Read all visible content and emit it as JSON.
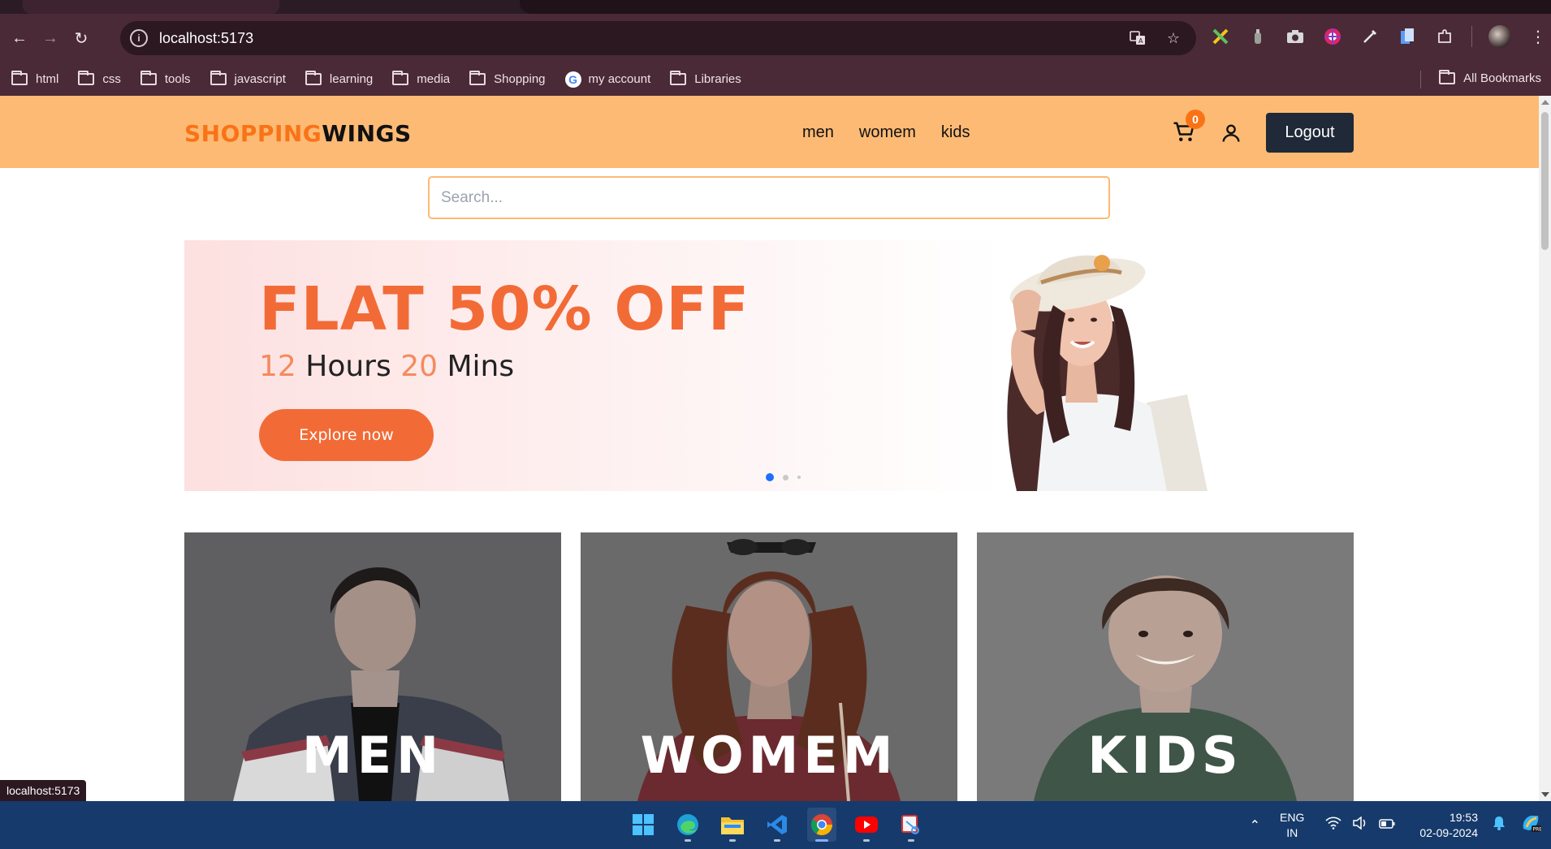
{
  "browser": {
    "url": "localhost:5173",
    "status_url": "localhost:5173",
    "bookmarks": [
      "html",
      "css",
      "tools",
      "javascript",
      "learning",
      "media",
      "Shopping",
      "my account",
      "Libraries"
    ],
    "all_bookmarks_label": "All Bookmarks"
  },
  "site": {
    "logo_part1": "SHOPPING",
    "logo_part2": "WINGS",
    "nav": [
      "men",
      "womem",
      "kids"
    ],
    "cart_count": "0",
    "logout_label": "Logout",
    "search_placeholder": "Search...",
    "accent_color": "#f97316",
    "header_color": "#fdba74"
  },
  "hero": {
    "title": "FLAT 50% OFF",
    "hours_value": "12",
    "hours_label": "Hours",
    "mins_value": "20",
    "mins_label": "Mins",
    "cta_label": "Explore now",
    "slides": 3,
    "active_slide": 1
  },
  "categories": [
    {
      "label": "MEN"
    },
    {
      "label": "WOMEM"
    },
    {
      "label": "KIDS"
    }
  ],
  "taskbar": {
    "lang_line1": "ENG",
    "lang_line2": "IN",
    "time": "19:53",
    "date": "02-09-2024"
  }
}
